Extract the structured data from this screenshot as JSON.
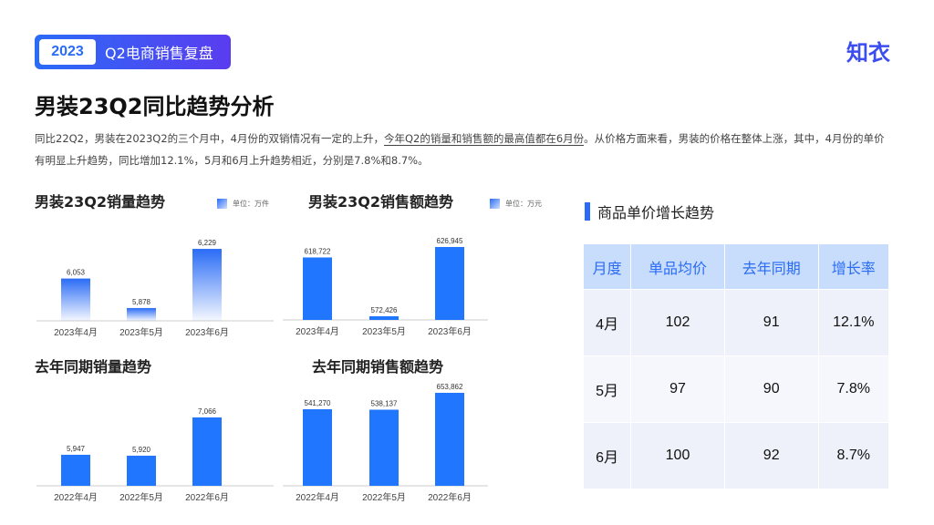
{
  "header": {
    "year": "2023",
    "subtitle": "Q2电商销售复盘",
    "logo": "知衣"
  },
  "title": "男装23Q2同比趋势分析",
  "description": {
    "part1": "同比22Q2，男装在2023Q2的三个月中，4月份的双销情况有一定的上升，",
    "highlight": "今年Q2的销量和销售额的最高值都在6月份",
    "part2": "。从价格方面来看，男装的价格在整体上涨，其中，4月份的单价有明显上升趋势，同比增加12.1%，5月和6月上升趋势相近，分别是7.8%和8.7%。"
  },
  "chart_data": [
    {
      "type": "bar",
      "title": "男装23Q2销量趋势",
      "legend": "单位：万件",
      "categories": [
        "2023年4月",
        "2023年5月",
        "2023年6月"
      ],
      "values": [
        6053,
        5878,
        6229
      ],
      "labels": [
        "6,053",
        "5,878",
        "6,229"
      ],
      "ylim": [
        5802,
        6397
      ],
      "gradient": true
    },
    {
      "type": "bar",
      "title": "男装23Q2销售额趋势",
      "legend": "单位：万元",
      "categories": [
        "2023年4月",
        "2023年5月",
        "2023年6月"
      ],
      "values": [
        618722,
        572426,
        626945
      ],
      "labels": [
        "618,722",
        "572,426",
        "626,945"
      ],
      "ylim": [
        569556,
        648466
      ],
      "gradient": false
    },
    {
      "type": "bar",
      "title": "去年同期销量趋势",
      "categories": [
        "2022年4月",
        "2022年5月",
        "2022年6月"
      ],
      "values": [
        5947,
        5920,
        7066
      ],
      "labels": [
        "5,947",
        "5,920",
        "7,066"
      ],
      "ylim": [
        5018,
        8020
      ],
      "gradient": false
    },
    {
      "type": "bar",
      "title": "去年同期销售额趋势",
      "categories": [
        "2022年4月",
        "2022年5月",
        "2022年6月"
      ],
      "values": [
        541270,
        538137,
        653862
      ],
      "labels": [
        "541,270",
        "538,137",
        "653,862"
      ],
      "ylim": [
        16270,
        703770
      ],
      "gradient": false
    }
  ],
  "price_table": {
    "title": "商品单价增长趋势",
    "headers": [
      "月度",
      "单品均价",
      "去年同期",
      "增长率"
    ],
    "rows": [
      [
        "4月",
        "102",
        "91",
        "12.1%"
      ],
      [
        "5月",
        "97",
        "90",
        "7.8%"
      ],
      [
        "6月",
        "100",
        "92",
        "8.7%"
      ]
    ]
  },
  "colors": {
    "accent": "#2a6cf6",
    "header_bg": "#c8dcfb"
  }
}
